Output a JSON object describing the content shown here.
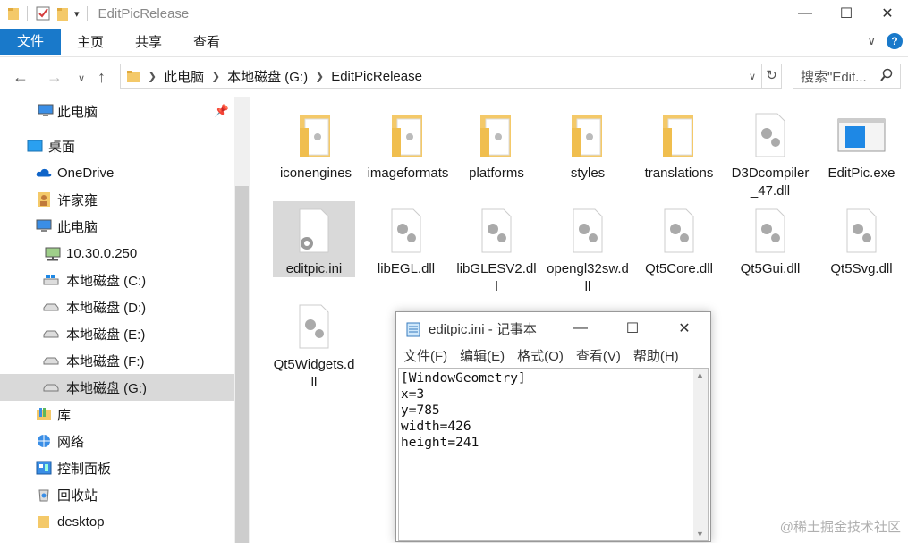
{
  "window": {
    "title": "EditPicRelease",
    "controls": {
      "minimize": "—",
      "maximize": "☐",
      "close": "✕"
    }
  },
  "ribbon": {
    "tabs": [
      "文件",
      "主页",
      "共享",
      "查看"
    ]
  },
  "address": {
    "crumbs": [
      "此电脑",
      "本地磁盘 (G:)",
      "EditPicRelease"
    ],
    "search_placeholder": "搜索\"Edit..."
  },
  "sidebar": {
    "items": [
      {
        "label": "此电脑",
        "icon": "pc-icon"
      },
      {
        "label": "桌面",
        "icon": "desktop-icon"
      },
      {
        "label": "OneDrive",
        "icon": "onedrive-icon"
      },
      {
        "label": "许家雍",
        "icon": "user-icon"
      },
      {
        "label": "此电脑",
        "icon": "pc-icon"
      },
      {
        "label": "10.30.0.250",
        "icon": "network-drive-icon"
      },
      {
        "label": "本地磁盘 (C:)",
        "icon": "windows-drive-icon"
      },
      {
        "label": "本地磁盘 (D:)",
        "icon": "drive-icon"
      },
      {
        "label": "本地磁盘 (E:)",
        "icon": "drive-icon"
      },
      {
        "label": "本地磁盘 (F:)",
        "icon": "drive-icon"
      },
      {
        "label": "本地磁盘 (G:)",
        "icon": "drive-icon",
        "selected": true
      },
      {
        "label": "库",
        "icon": "library-icon"
      },
      {
        "label": "网络",
        "icon": "network-icon"
      },
      {
        "label": "控制面板",
        "icon": "control-panel-icon"
      },
      {
        "label": "回收站",
        "icon": "recycle-bin-icon"
      },
      {
        "label": "desktop",
        "icon": "folder-icon"
      }
    ]
  },
  "files": [
    {
      "name": "iconengines",
      "icon": "folder-icon"
    },
    {
      "name": "imageformats",
      "icon": "folder-icon"
    },
    {
      "name": "platforms",
      "icon": "folder-icon"
    },
    {
      "name": "styles",
      "icon": "folder-icon"
    },
    {
      "name": "translations",
      "icon": "folder-icon"
    },
    {
      "name": "D3Dcompiler_47.dll",
      "icon": "dll-icon"
    },
    {
      "name": "EditPic.exe",
      "icon": "exe-icon"
    },
    {
      "name": "editpic.ini",
      "icon": "ini-icon",
      "selected": true
    },
    {
      "name": "libEGL.dll",
      "icon": "dll-icon"
    },
    {
      "name": "libGLESV2.dll",
      "icon": "dll-icon"
    },
    {
      "name": "opengl32sw.dll",
      "icon": "dll-icon"
    },
    {
      "name": "Qt5Core.dll",
      "icon": "dll-icon"
    },
    {
      "name": "Qt5Gui.dll",
      "icon": "dll-icon"
    },
    {
      "name": "Qt5Svg.dll",
      "icon": "dll-icon"
    },
    {
      "name": "Qt5Widgets.dll",
      "icon": "dll-icon"
    }
  ],
  "notepad": {
    "title": "editpic.ini - 记事本",
    "menu": [
      "文件(F)",
      "编辑(E)",
      "格式(O)",
      "查看(V)",
      "帮助(H)"
    ],
    "content": "[WindowGeometry]\nx=3\ny=785\nwidth=426\nheight=241"
  },
  "watermark": "@稀土掘金技术社区",
  "colors": {
    "accent": "#1979ca",
    "folder": "#f4c969",
    "selection": "#d9d9d9"
  }
}
